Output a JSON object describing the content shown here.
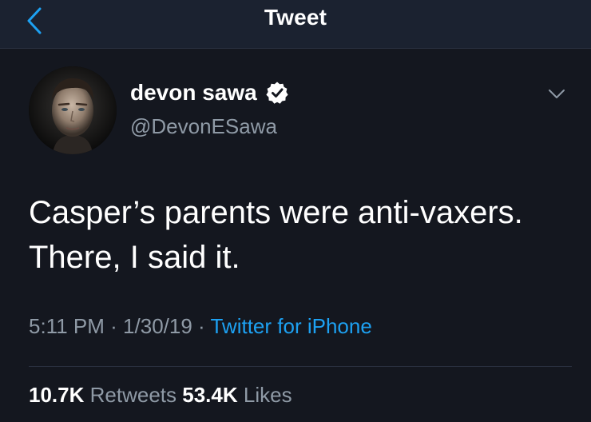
{
  "header": {
    "title": "Tweet",
    "back_icon": "chevron-left-icon"
  },
  "tweet": {
    "author": {
      "display_name": "devon sawa",
      "handle": "@DevonESawa",
      "verified": true,
      "verified_icon": "verified-badge-icon"
    },
    "menu_icon": "chevron-down-icon",
    "text": "Casper’s parents were anti-vaxers.\nThere, I said it.",
    "time": "5:11 PM",
    "date": "1/30/19",
    "source": "Twitter for iPhone",
    "separator": "·",
    "stats": {
      "retweets_count": "10.7K",
      "retweets_label": "Retweets",
      "likes_count": "53.4K",
      "likes_label": "Likes"
    }
  },
  "colors": {
    "background": "#14171f",
    "accent": "#1da1f2",
    "secondary_text": "#8f9aa6"
  }
}
